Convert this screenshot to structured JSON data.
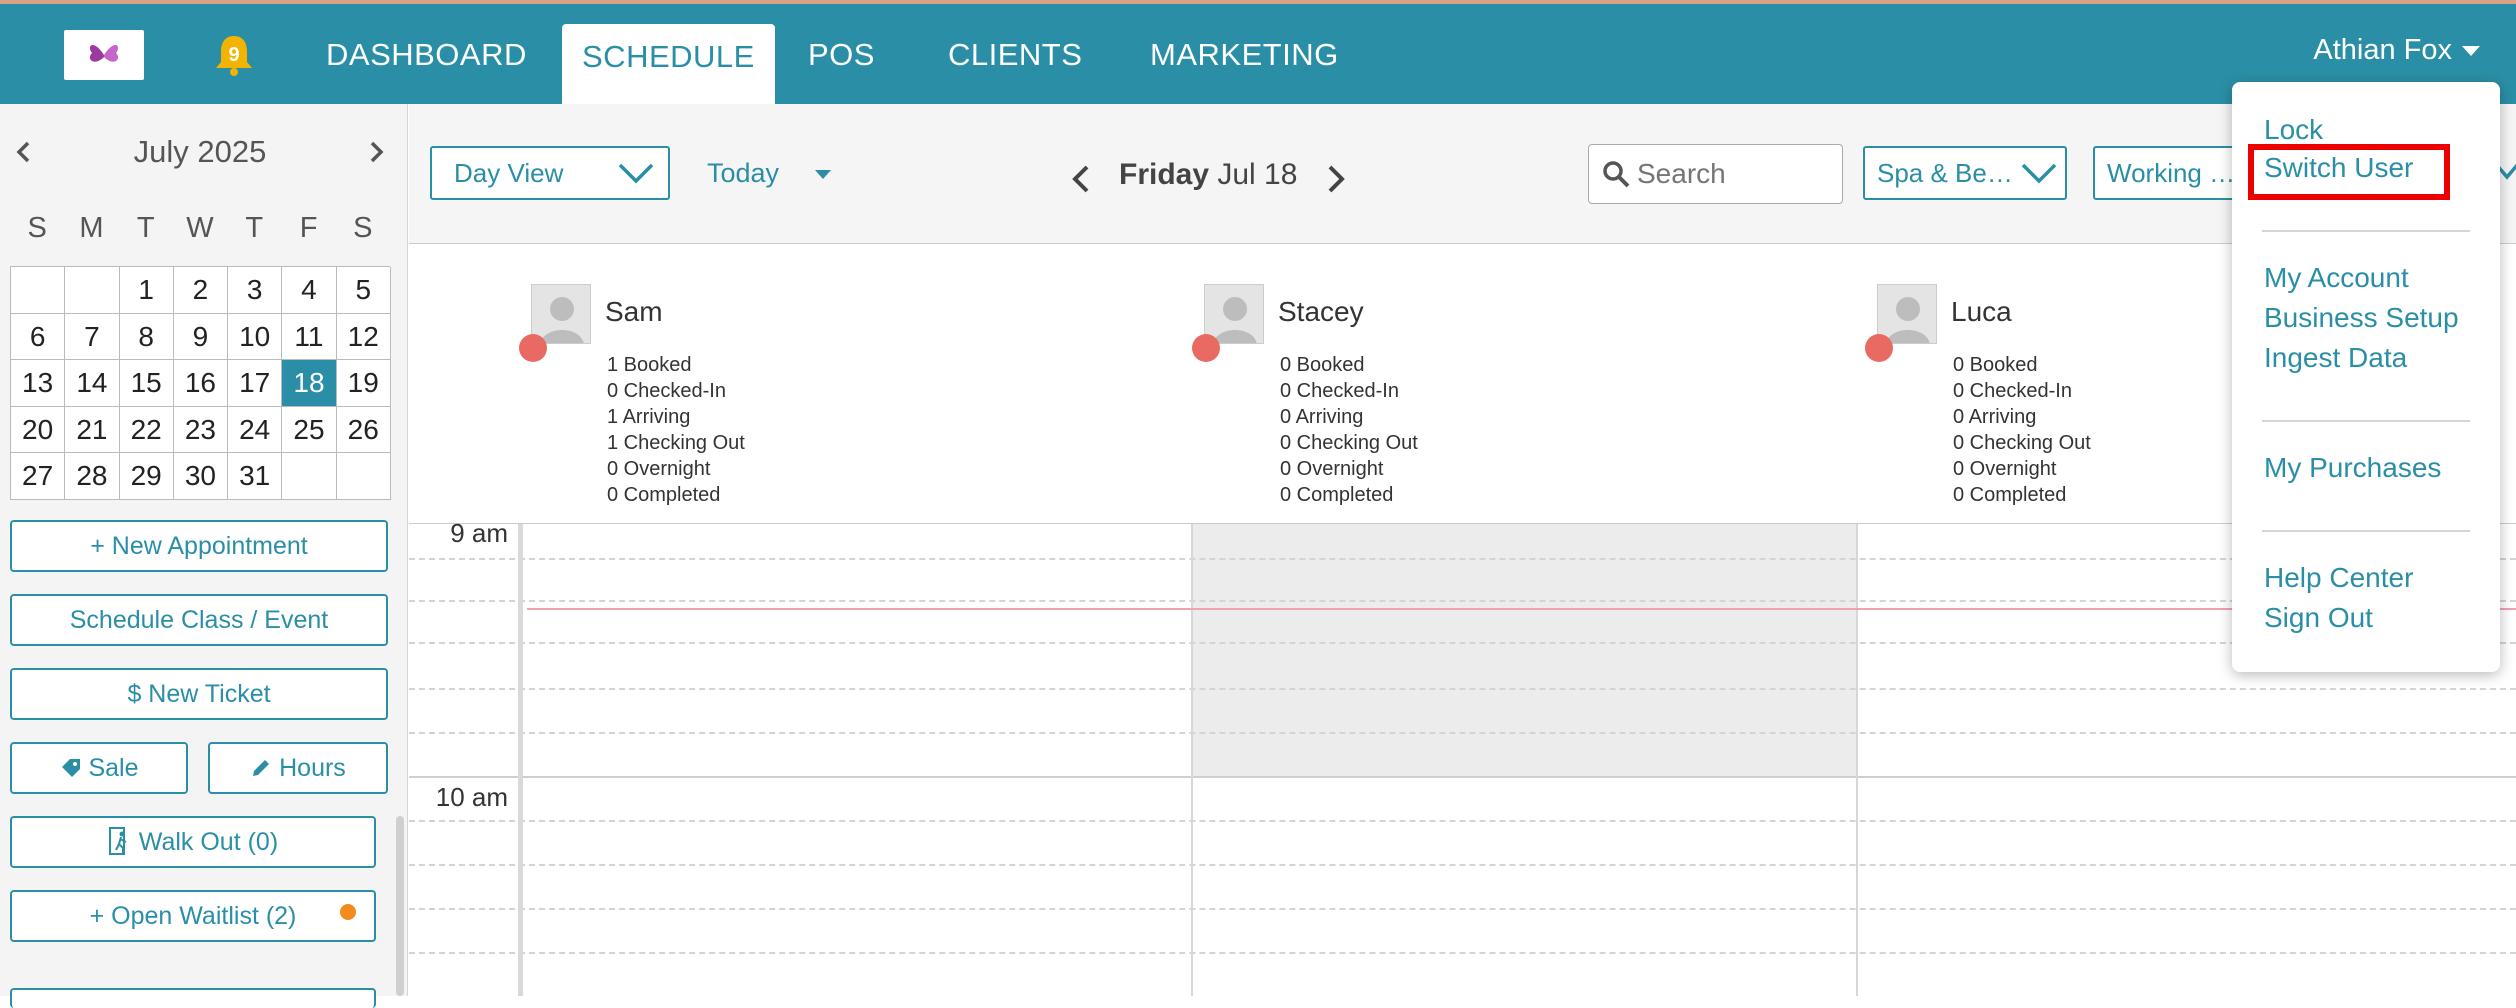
{
  "nav": {
    "notification_count": "9",
    "items": [
      "DASHBOARD",
      "SCHEDULE",
      "POS",
      "CLIENTS",
      "MARKETING"
    ],
    "active": "SCHEDULE",
    "user_name": "Athian Fox",
    "brand_color": "#2a8fa6"
  },
  "calendar": {
    "month_label": "July 2025",
    "weekdays": [
      "S",
      "M",
      "T",
      "W",
      "T",
      "F",
      "S"
    ],
    "days": [
      "",
      "",
      "1",
      "2",
      "3",
      "4",
      "5",
      "6",
      "7",
      "8",
      "9",
      "10",
      "11",
      "12",
      "13",
      "14",
      "15",
      "16",
      "17",
      "18",
      "19",
      "20",
      "21",
      "22",
      "23",
      "24",
      "25",
      "26",
      "27",
      "28",
      "29",
      "30",
      "31",
      "",
      ""
    ],
    "selected_day": "18"
  },
  "actions": {
    "new_appointment": "+ New Appointment",
    "schedule_class": "Schedule Class / Event",
    "new_ticket": "$  New Ticket",
    "sale": "Sale",
    "hours": "Hours",
    "walk_out": "Walk Out (0)",
    "open_waitlist": "+ Open Waitlist (2)"
  },
  "toolbar": {
    "view_select": "Day View",
    "today_label": "Today",
    "day_name": "Friday",
    "date_label": "Jul 18",
    "search_placeholder": "Search",
    "location_select": "Spa & Be…",
    "staff_filter": "Working …"
  },
  "staff": [
    {
      "name": "Sam",
      "stats": [
        "1 Booked",
        "0 Checked-In",
        "1 Arriving",
        "1 Checking Out",
        "0 Overnight",
        "0 Completed"
      ]
    },
    {
      "name": "Stacey",
      "stats": [
        "0 Booked",
        "0 Checked-In",
        "0 Arriving",
        "0 Checking Out",
        "0 Overnight",
        "0 Completed"
      ]
    },
    {
      "name": "Luca",
      "stats": [
        "0 Booked",
        "0 Checked-In",
        "0 Arriving",
        "0 Checking Out",
        "0 Overnight",
        "0 Completed"
      ]
    }
  ],
  "time_labels": [
    "9 am",
    "10 am"
  ],
  "user_dropdown": {
    "lock": "Lock",
    "switch_user": "Switch User",
    "my_account": "My Account",
    "business_setup": "Business Setup",
    "ingest_data": "Ingest Data",
    "my_purchases": "My Purchases",
    "help_center": "Help Center",
    "sign_out": "Sign Out"
  }
}
